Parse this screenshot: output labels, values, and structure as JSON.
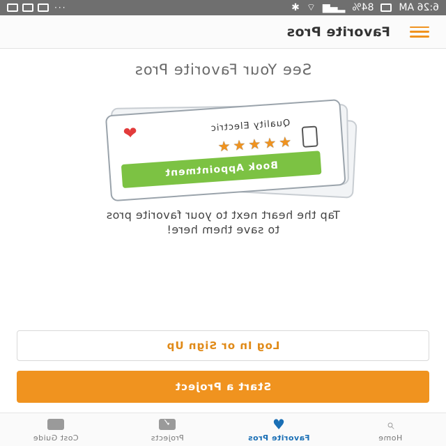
{
  "status_bar": {
    "time": "6:26 AM",
    "battery": "84%",
    "dots": "···"
  },
  "app_bar": {
    "title": "Favorite Pros"
  },
  "main": {
    "headline": "See Your Favorite Pros",
    "card": {
      "name": "Quality Electric",
      "rating": 5,
      "book_label": "Book Appointment"
    },
    "info_line1": "Tap the heart next to your favorite pros",
    "info_line2": "to save them here!",
    "login_label": "Log In or Sign Up",
    "start_label": "Start a Project"
  },
  "bottom_nav": {
    "items": [
      {
        "label": "Home",
        "icon": "search-icon"
      },
      {
        "label": "Favorite Pros",
        "icon": "heart-icon",
        "active": true
      },
      {
        "label": "Projects",
        "icon": "checkbox-icon"
      },
      {
        "label": "Cost Guide",
        "icon": "tag-icon"
      }
    ]
  },
  "colors": {
    "accent": "#f0931f",
    "active_nav": "#1a6fb5",
    "book_green": "#7cc243"
  }
}
